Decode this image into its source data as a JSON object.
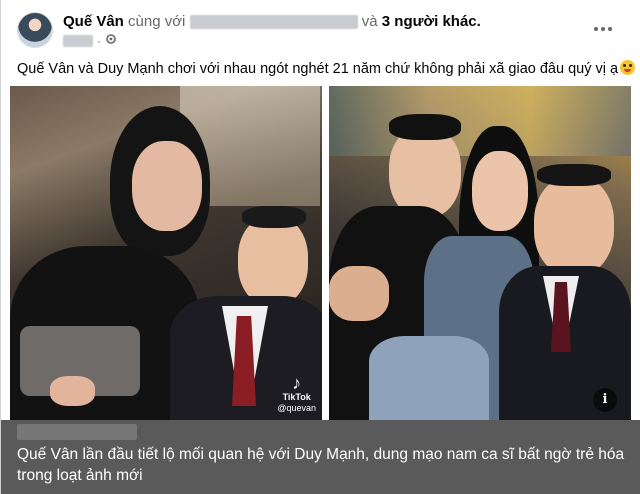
{
  "post": {
    "author": "Quế Vân",
    "with_text": "cùng với",
    "and_text": "và",
    "others": "3 người khác.",
    "more_icon": "more-horizontal-icon",
    "privacy_icon": "privacy-settings-icon",
    "caption": "Quế Vân và Duy Mạnh chơi với nhau ngót nghét 21 năm chứ không phải xã giao đâu quý vị ạ",
    "emoji": "grinning-face-tongue-emoji"
  },
  "photos": {
    "left_watermark_logo": "♪",
    "left_watermark_brand": "TikTok",
    "left_watermark_handle": "@quevan",
    "info_label": "i"
  },
  "footer": {
    "headline": "Quế Vân lần đầu tiết lộ mối quan hệ với Duy Mạnh, dung mạo nam ca sĩ bất ngờ trẻ hóa trong loạt ảnh mới"
  },
  "colors": {
    "muted_text": "#65676b",
    "footer_bg": "#5a5a5a"
  }
}
